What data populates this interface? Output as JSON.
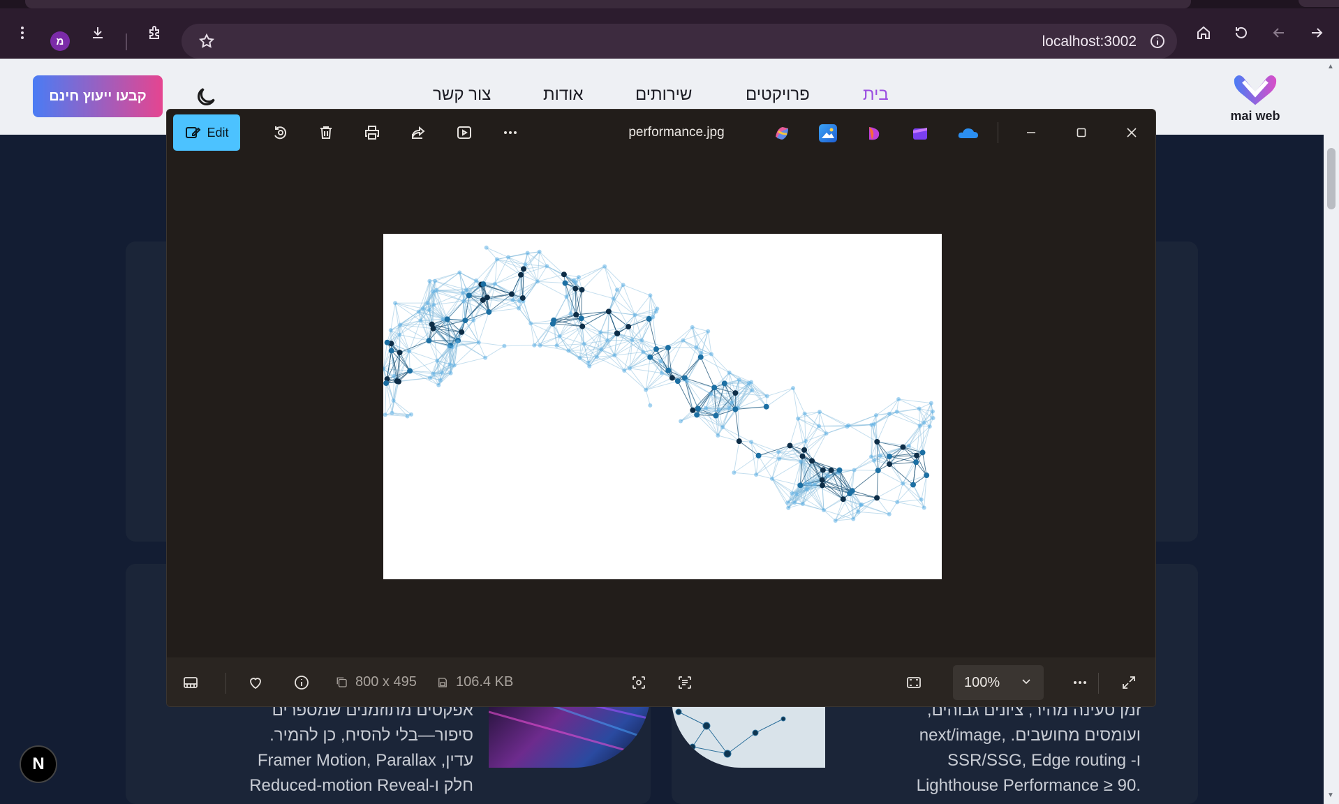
{
  "browser": {
    "url": "localhost:3002",
    "profile_initial": "מ"
  },
  "site": {
    "cta_label": "קבעו ייעוץ חינם",
    "nav": {
      "home": "בית",
      "projects": "פרויקטים",
      "services": "שירותים",
      "about": "אודות",
      "contact": "צור קשר"
    },
    "logo_text": "mai web",
    "left_card_lines": [
      "אפקטים מתוזמנים שמספרים",
      "סיפור—בלי להסיח, כן להמיר.",
      "עדין, Framer Motion, Parallax",
      "חלק ו-Reduced-motion Reveal"
    ],
    "right_card_lines": [
      "זמן טעינה מהיר, ציונים גבוהים,",
      "ועומסים מחושבים. ,next/image",
      "ו- SSR/SSG, Edge routing",
      ".Lighthouse Performance ≥ 90"
    ],
    "next_badge": "N",
    "accent_nav": "#9b4ee0"
  },
  "photos": {
    "edit_label": "Edit",
    "file_name": "performance.jpg",
    "dimensions": "800 x 495",
    "file_size": "106.4 KB",
    "zoom": "100%",
    "accent": "#4cc2ff",
    "toolbar_icons": [
      "rotate-icon",
      "delete-icon",
      "print-icon",
      "share-icon",
      "slideshow-icon",
      "more-icon"
    ],
    "app_icons": [
      "copilot-icon",
      "photos-app-icon",
      "designer-icon",
      "clipchamp-icon",
      "onedrive-icon"
    ]
  }
}
